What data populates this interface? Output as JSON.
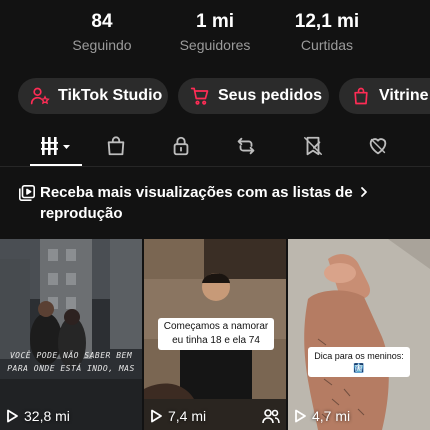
{
  "stats": [
    {
      "value": "84",
      "label": "Seguindo"
    },
    {
      "value": "1 mi",
      "label": "Seguidores"
    },
    {
      "value": "12,1 mi",
      "label": "Curtidas"
    }
  ],
  "pills": [
    {
      "label": "TikTok Studio",
      "icon": "person-star-icon"
    },
    {
      "label": "Seus pedidos",
      "icon": "cart-icon"
    },
    {
      "label": "Vitrine",
      "icon": "shopping-bag-icon"
    }
  ],
  "tabs": [
    "videos-grid-icon",
    "shop-bag-icon",
    "lock-icon",
    "repost-icon",
    "saved-bookmark-icon",
    "liked-heart-icon"
  ],
  "banner": {
    "text": "Receba mais visualizações com as listas de reprodução"
  },
  "videos": [
    {
      "views": "32,8 mi",
      "caption": "VOCÊ PODE NÃO SABER BEM PARA ONDE ESTÁ INDO, MAS"
    },
    {
      "views": "7,4 mi",
      "caption": "Começamos a namorar eu tinha 18 e ela 74"
    },
    {
      "views": "4,7 mi",
      "caption": "Dica para os meninos: 🩻"
    }
  ],
  "colors": {
    "accent": "#fe2c55",
    "background": "#121212",
    "pill": "#2b2b2b"
  }
}
